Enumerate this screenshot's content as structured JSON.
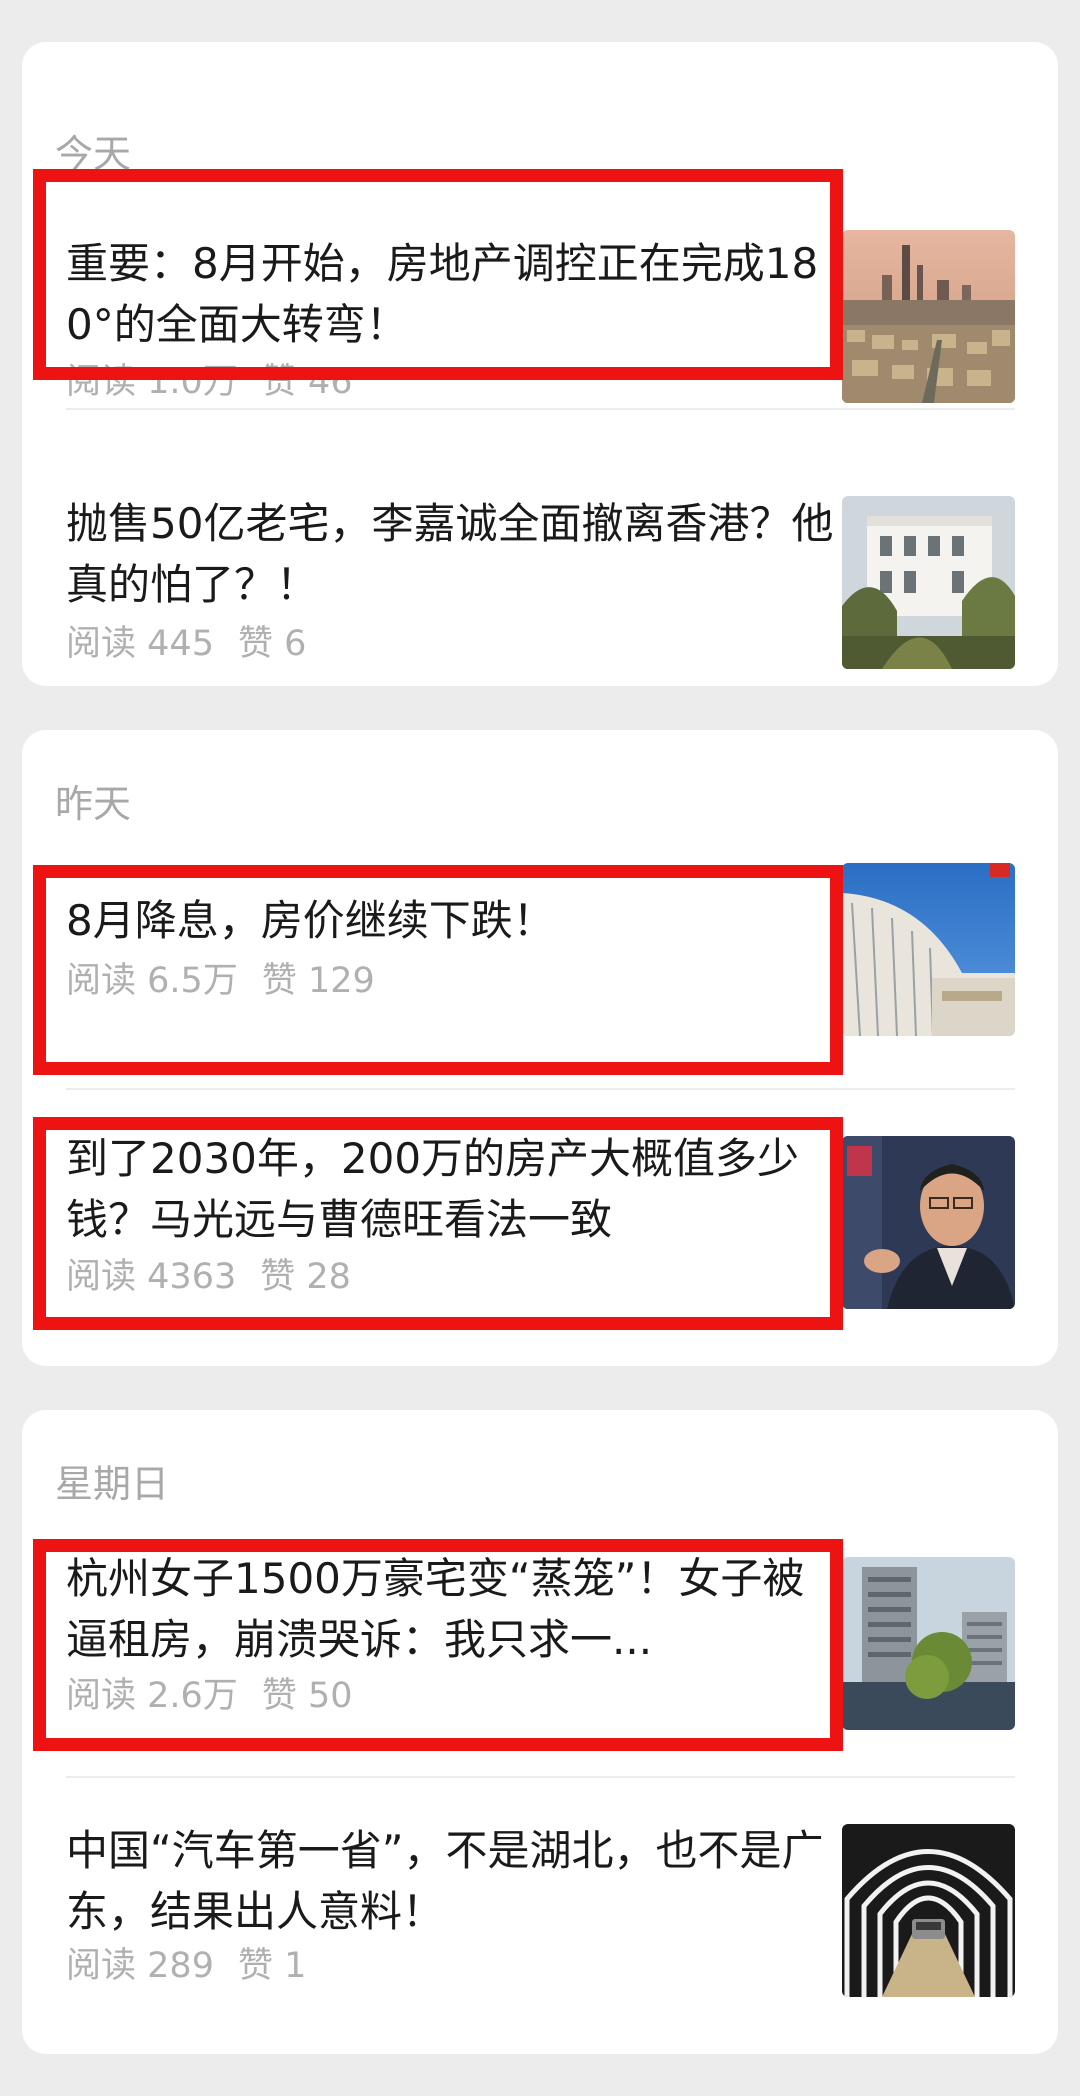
{
  "groups": [
    {
      "label": "今天",
      "articles": [
        {
          "title": "重要：8月开始，房地产调控正在完成180°的全面大转弯！",
          "read_label": "阅读",
          "reads": "1.0万",
          "like_label": "赞",
          "likes": "46",
          "thumbnail": "city-skyline-image",
          "highlighted": true
        },
        {
          "title": "抛售50亿老宅，李嘉诚全面撤离香港？他真的怕了？！",
          "read_label": "阅读",
          "reads": "445",
          "like_label": "赞",
          "likes": "6",
          "thumbnail": "white-mansion-image",
          "highlighted": false
        }
      ]
    },
    {
      "label": "昨天",
      "articles": [
        {
          "title": "8月降息，房价继续下跌！",
          "read_label": "阅读",
          "reads": "6.5万",
          "like_label": "赞",
          "likes": "129",
          "thumbnail": "bank-building-image",
          "highlighted": true
        },
        {
          "title": "到了2030年，200万的房产大概值多少钱？马光远与曹德旺看法一致",
          "read_label": "阅读",
          "reads": "4363",
          "like_label": "赞",
          "likes": "28",
          "thumbnail": "speaker-portrait-image",
          "highlighted": true
        }
      ]
    },
    {
      "label": "星期日",
      "articles": [
        {
          "title": "杭州女子1500万豪宅变“蒸笼”！女子被逼租房，崩溃哭诉：我只求一...",
          "read_label": "阅读",
          "reads": "2.6万",
          "like_label": "赞",
          "likes": "50",
          "thumbnail": "apartment-towers-image",
          "highlighted": true
        },
        {
          "title": "中国“汽车第一省”，不是湖北，也不是广东，结果出人意料！",
          "read_label": "阅读",
          "reads": "289",
          "like_label": "赞",
          "likes": "1",
          "thumbnail": "tunnel-car-image",
          "highlighted": false
        }
      ]
    }
  ],
  "colors": {
    "background": "#ececec",
    "card": "#ffffff",
    "highlight": "#ee1313",
    "meta_text": "#b0b0b0",
    "title_text": "#1a1a1a"
  }
}
